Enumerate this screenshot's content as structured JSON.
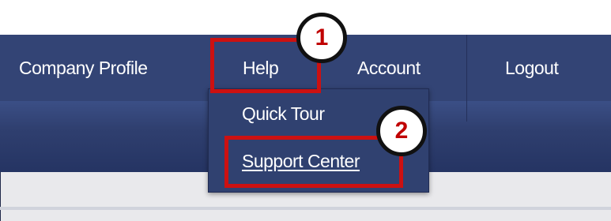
{
  "nav": {
    "items": [
      {
        "label": "Company Profile"
      },
      {
        "label": "Help"
      },
      {
        "label": "Account"
      },
      {
        "label": "Logout"
      }
    ]
  },
  "help_menu": {
    "items": [
      {
        "label": "Quick Tour"
      },
      {
        "label": "Support Center"
      }
    ]
  },
  "annotations": {
    "step1": "1",
    "step2": "2",
    "highlight_color": "#cc1111"
  }
}
